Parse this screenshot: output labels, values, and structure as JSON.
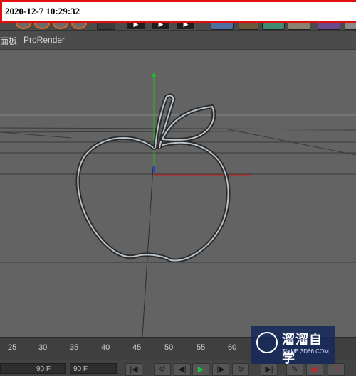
{
  "timestamp": "2020-12-7  10:29:32",
  "menubar": {
    "items": [
      "面板",
      "ProRender"
    ]
  },
  "timeline": {
    "ticks": [
      "25",
      "30",
      "35",
      "40",
      "45",
      "50",
      "55",
      "60"
    ]
  },
  "transport": {
    "start_frame": "90 F",
    "end_frame": "90 F"
  },
  "watermark": {
    "title": "溜溜自学",
    "url": "ZIXUE.3D66.COM"
  },
  "colors": {
    "timestamp_border": "#e01010",
    "y_axis": "#22bb22",
    "x_axis": "#cc2222",
    "play_button": "#20c040"
  },
  "icons": [
    "toolbar-render-icon",
    "toolbar-play-icon",
    "first-frame-icon",
    "prev-key-icon",
    "play-icon",
    "next-key-icon",
    "last-frame-icon",
    "record-icon",
    "help-icon"
  ]
}
